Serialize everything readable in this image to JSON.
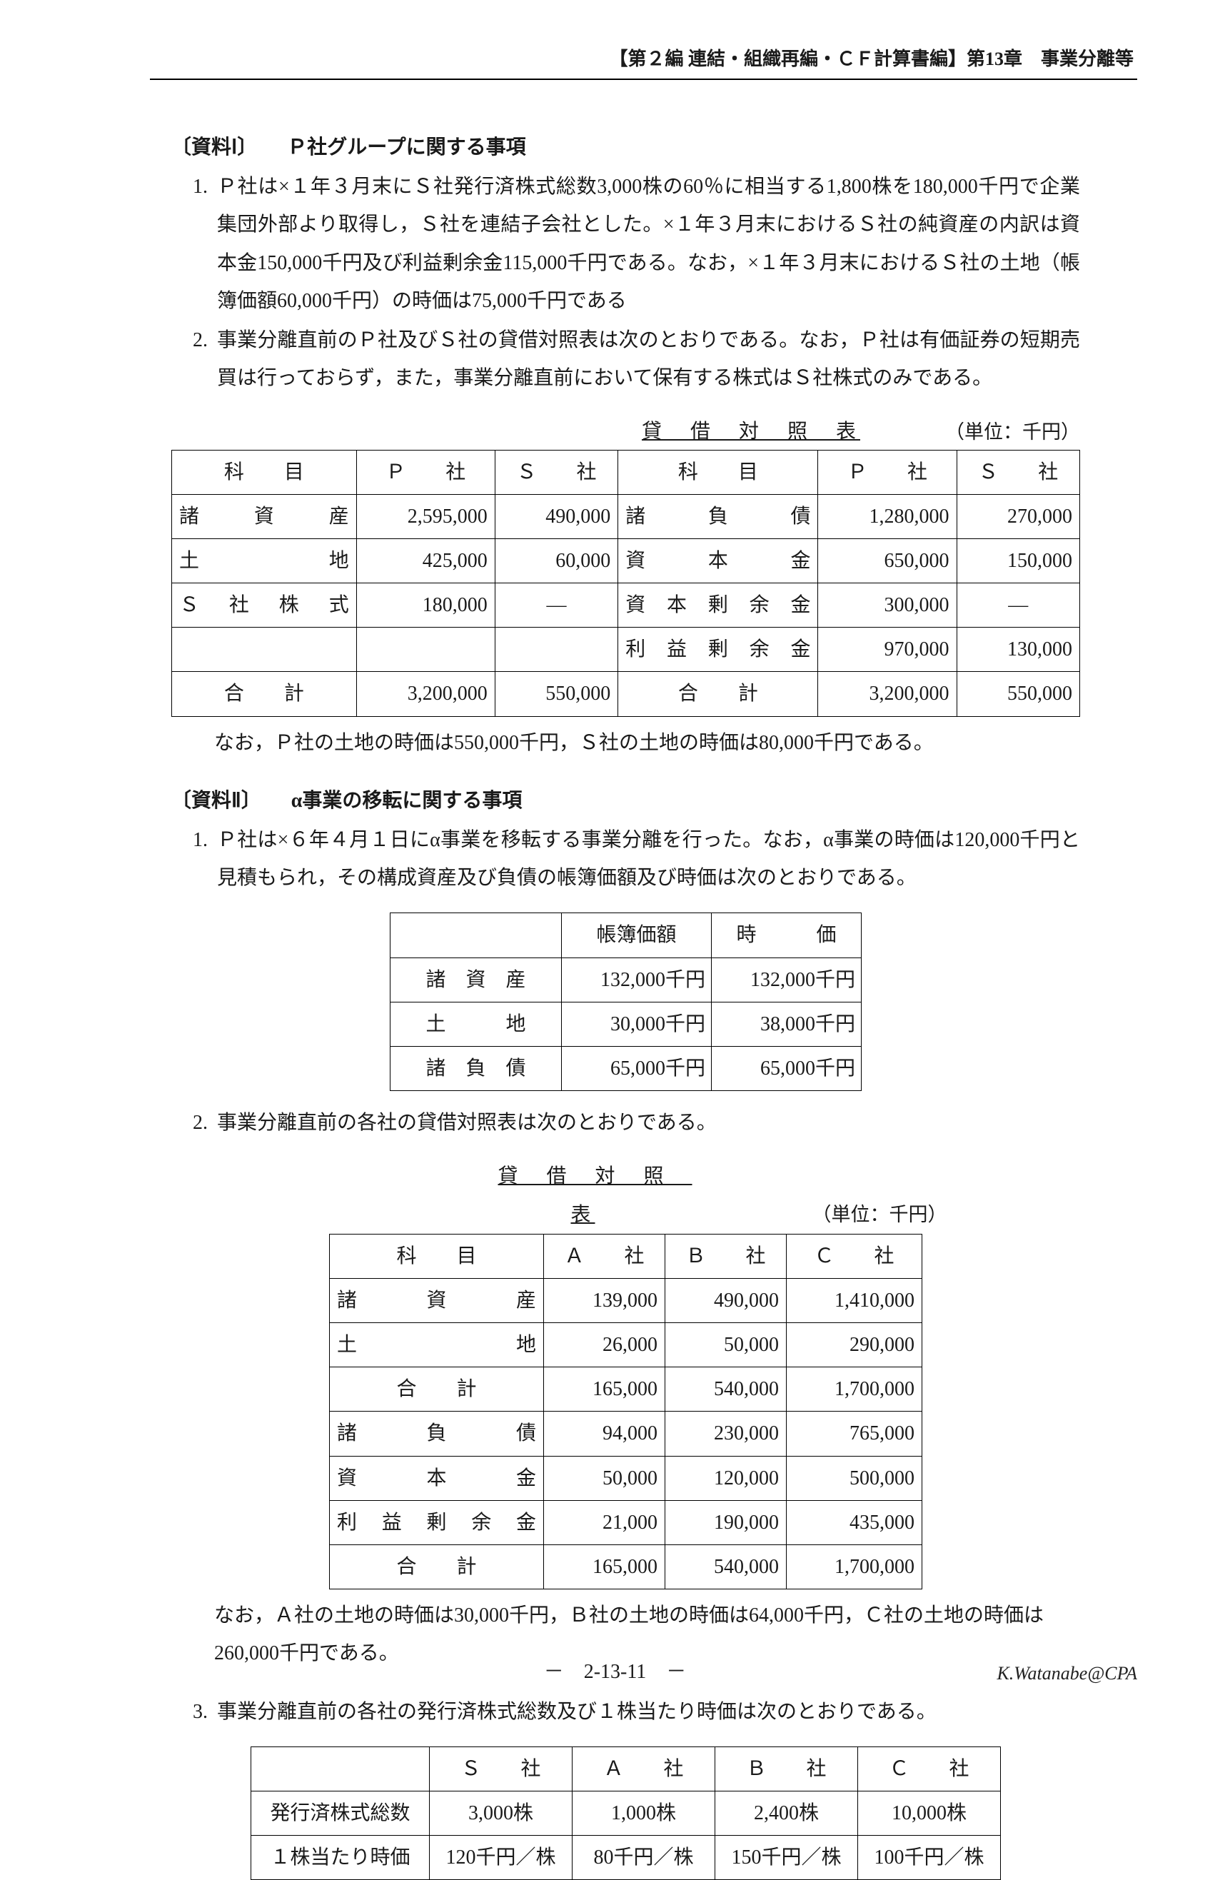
{
  "header": {
    "right": "【第２編 連結・組織再編・ＣＦ計算書編】第13章　事業分離等"
  },
  "sec1": {
    "title": "〔資料Ⅰ〕　　Ｐ社グループに関する事項",
    "items": [
      "Ｐ社は×１年３月末にＳ社発行済株式総数3,000株の60％に相当する1,800株を180,000千円で企業集団外部より取得し，Ｓ社を連結子会社とした。×１年３月末におけるＳ社の純資産の内訳は資本金150,000千円及び利益剰余金115,000千円である。なお，×１年３月末におけるＳ社の土地（帳簿価額60,000千円）の時価は75,000千円である",
      "事業分離直前のＰ社及びＳ社の貸借対照表は次のとおりである。なお，Ｐ社は有価証券の短期売買は行っておらず，また，事業分離直前において保有する株式はＳ社株式のみである。"
    ]
  },
  "bs1": {
    "caption": "貸　借　対　照　表",
    "unit": "（単位：千円）",
    "head": {
      "kamoku": "科　　目",
      "p": "Ｐ　　社",
      "s": "Ｓ　　社"
    },
    "left": {
      "rows": [
        {
          "k": "諸資産",
          "p": "2,595,000",
          "s": "490,000"
        },
        {
          "k": "土地",
          "p": "425,000",
          "s": "60,000"
        },
        {
          "k": "Ｓ社株式",
          "p": "180,000",
          "s": "―"
        }
      ],
      "total": {
        "k": "合　　計",
        "p": "3,200,000",
        "s": "550,000"
      }
    },
    "right": {
      "rows": [
        {
          "k": "諸負債",
          "p": "1,280,000",
          "s": "270,000"
        },
        {
          "k": "資本金",
          "p": "650,000",
          "s": "150,000"
        },
        {
          "k": "資本剰余金",
          "p": "300,000",
          "s": "―"
        },
        {
          "k": "利益剰余金",
          "p": "970,000",
          "s": "130,000"
        }
      ],
      "total": {
        "k": "合　　計",
        "p": "3,200,000",
        "s": "550,000"
      }
    },
    "note": "なお，Ｐ社の土地の時価は550,000千円，Ｓ社の土地の時価は80,000千円である。"
  },
  "sec2": {
    "title": "〔資料Ⅱ〕　　α事業の移転に関する事項",
    "items": [
      "Ｐ社は×６年４月１日にα事業を移転する事業分離を行った。なお，α事業の時価は120,000千円と見積もられ，その構成資産及び負債の帳簿価額及び時価は次のとおりである。",
      "事業分離直前の各社の貸借対照表は次のとおりである。",
      "事業分離直前の各社の発行済株式総数及び１株当たり時価は次のとおりである。"
    ]
  },
  "alpha": {
    "head": {
      "bv": "帳簿価額",
      "fv": "時　　　価"
    },
    "rows": [
      {
        "k": "諸　資　産",
        "bv": "132,000千円",
        "fv": "132,000千円"
      },
      {
        "k": "土　　　地",
        "bv": "30,000千円",
        "fv": "38,000千円"
      },
      {
        "k": "諸　負　債",
        "bv": "65,000千円",
        "fv": "65,000千円"
      }
    ]
  },
  "bs2": {
    "caption": "貸　借　対　照　表",
    "unit": "（単位：千円）",
    "head": {
      "kamoku": "科　　目",
      "a": "Ａ　　社",
      "b": "Ｂ　　社",
      "c": "Ｃ　　社"
    },
    "rows": [
      {
        "k": "諸資産",
        "a": "139,000",
        "b": "490,000",
        "c": "1,410,000"
      },
      {
        "k": "土地",
        "a": "26,000",
        "b": "50,000",
        "c": "290,000"
      },
      {
        "k": "合　　計",
        "a": "165,000",
        "b": "540,000",
        "c": "1,700,000",
        "total": true
      },
      {
        "k": "諸負債",
        "a": "94,000",
        "b": "230,000",
        "c": "765,000"
      },
      {
        "k": "資本金",
        "a": "50,000",
        "b": "120,000",
        "c": "500,000"
      },
      {
        "k": "利益剰余金",
        "a": "21,000",
        "b": "190,000",
        "c": "435,000"
      },
      {
        "k": "合　　計",
        "a": "165,000",
        "b": "540,000",
        "c": "1,700,000",
        "total": true
      }
    ],
    "note": "なお，Ａ社の土地の時価は30,000千円，Ｂ社の土地の時価は64,000千円，Ｃ社の土地の時価は260,000千円である。"
  },
  "shares": {
    "head": {
      "s": "Ｓ　　社",
      "a": "Ａ　　社",
      "b": "Ｂ　　社",
      "c": "Ｃ　　社"
    },
    "rows": [
      {
        "k": "発行済株式総数",
        "s": "3,000株",
        "a": "1,000株",
        "b": "2,400株",
        "c": "10,000株"
      },
      {
        "k": "１株当たり時価",
        "s": "120千円／株",
        "a": "80千円／株",
        "b": "150千円／株",
        "c": "100千円／株"
      }
    ]
  },
  "footer": {
    "page": "－　2-13-11　－",
    "sig": "K.Watanabe@CPA"
  }
}
